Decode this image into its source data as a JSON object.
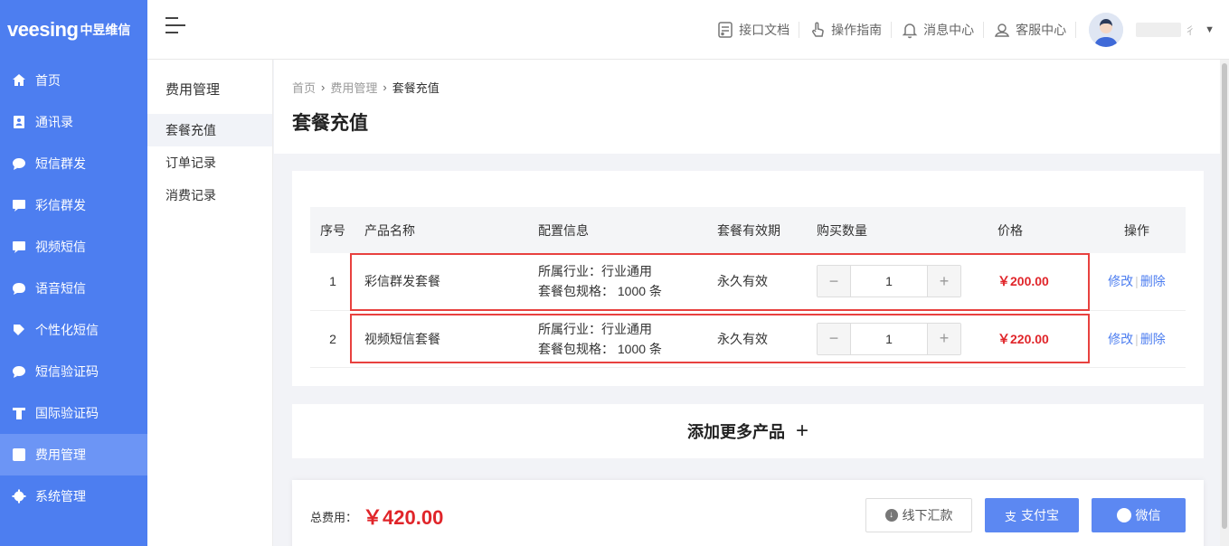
{
  "logo": {
    "brand": "veesing",
    "brand_cn": "中昱维信"
  },
  "nav": [
    {
      "label": "首页",
      "icon": "home-icon"
    },
    {
      "label": "通讯录",
      "icon": "contacts-icon"
    },
    {
      "label": "短信群发",
      "icon": "sms-icon"
    },
    {
      "label": "彩信群发",
      "icon": "mms-icon"
    },
    {
      "label": "视频短信",
      "icon": "video-sms-icon"
    },
    {
      "label": "语音短信",
      "icon": "voice-sms-icon"
    },
    {
      "label": "个性化短信",
      "icon": "personalized-sms-icon"
    },
    {
      "label": "短信验证码",
      "icon": "sms-code-icon"
    },
    {
      "label": "国际验证码",
      "icon": "intl-code-icon"
    },
    {
      "label": "费用管理",
      "icon": "yen-icon",
      "active": true
    },
    {
      "label": "系统管理",
      "icon": "gear-icon"
    }
  ],
  "header": {
    "links": [
      {
        "label": "接口文档",
        "icon": "api-doc-icon"
      },
      {
        "label": "操作指南",
        "icon": "hand-pointer-icon"
      },
      {
        "label": "消息中心",
        "icon": "bell-icon"
      },
      {
        "label": "客服中心",
        "icon": "support-agent-icon"
      }
    ],
    "username_suffix": "彳"
  },
  "subnav": {
    "title": "费用管理",
    "items": [
      {
        "label": "套餐充值",
        "active": true
      },
      {
        "label": "订单记录"
      },
      {
        "label": "消费记录"
      }
    ]
  },
  "breadcrumb": {
    "home": "首页",
    "parent": "费用管理",
    "current": "套餐充值"
  },
  "page_title": "套餐充值",
  "table": {
    "headers": [
      "序号",
      "产品名称",
      "配置信息",
      "套餐有效期",
      "购买数量",
      "价格",
      "操作"
    ],
    "rows": [
      {
        "idx": "1",
        "name": "彩信群发套餐",
        "cfg_industry": "所属行业：行业通用",
        "cfg_spec": "套餐包规格： 1000 条",
        "valid": "永久有效",
        "qty": "1",
        "price": "￥200.00",
        "edit": "修改",
        "del": "删除"
      },
      {
        "idx": "2",
        "name": "视频短信套餐",
        "cfg_industry": "所属行业：行业通用",
        "cfg_spec": "套餐包规格： 1000 条",
        "valid": "永久有效",
        "qty": "1",
        "price": "￥220.00",
        "edit": "修改",
        "del": "删除"
      }
    ],
    "op_separator": "|"
  },
  "add_more": {
    "label": "添加更多产品",
    "plus": "+"
  },
  "footer": {
    "total_label": "总费用：",
    "total_value": "￥420.00",
    "offline_label": "线下汇款",
    "alipay_label": "支付宝",
    "wechat_label": "微信"
  },
  "colors": {
    "primary": "#4d7ef0",
    "price_red": "#e0252a",
    "highlight_border": "#e8413f"
  }
}
